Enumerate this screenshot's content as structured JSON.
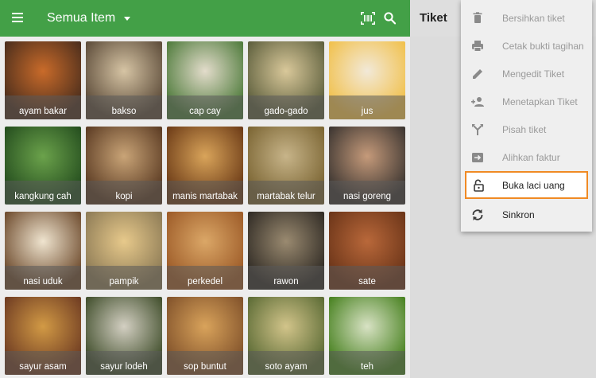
{
  "appbar": {
    "title": "Semua Item",
    "icons": [
      "menu-icon",
      "caret-down-icon",
      "barcode-scan-icon",
      "search-icon"
    ],
    "color": "#43a047"
  },
  "ticket": {
    "title": "Tiket"
  },
  "items": [
    {
      "label": "ayam bakar",
      "photo": [
        "#4a2d1c",
        "#c96b2a"
      ]
    },
    {
      "label": "bakso",
      "photo": [
        "#5b4a38",
        "#d6c4a4"
      ]
    },
    {
      "label": "cap cay",
      "photo": [
        "#4d7a3a",
        "#e3dccb"
      ]
    },
    {
      "label": "gado-gado",
      "photo": [
        "#5c5e3c",
        "#d9c89a"
      ]
    },
    {
      "label": "jus",
      "photo": [
        "#f1c04a",
        "#f2e9d8"
      ]
    },
    {
      "label": "kangkung cah",
      "photo": [
        "#244d1e",
        "#6ba24b"
      ]
    },
    {
      "label": "kopi",
      "photo": [
        "#5a3a22",
        "#c9a477"
      ]
    },
    {
      "label": "manis martabak",
      "photo": [
        "#6b3a16",
        "#d9a45a"
      ]
    },
    {
      "label": "martabak telur",
      "photo": [
        "#7a6432",
        "#c7b489"
      ]
    },
    {
      "label": "nasi goreng",
      "photo": [
        "#3a3430",
        "#c59a7a"
      ]
    },
    {
      "label": "nasi uduk",
      "photo": [
        "#6d4a2c",
        "#efe4cf"
      ]
    },
    {
      "label": "pampik",
      "photo": [
        "#8c7a55",
        "#e7c98b"
      ]
    },
    {
      "label": "perkedel",
      "photo": [
        "#9c5a27",
        "#dba767"
      ]
    },
    {
      "label": "rawon",
      "photo": [
        "#2f2a24",
        "#9a8a70"
      ]
    },
    {
      "label": "sate",
      "photo": [
        "#6a3418",
        "#b9683a"
      ]
    },
    {
      "label": "sayur asam",
      "photo": [
        "#6e3b22",
        "#d29a45"
      ]
    },
    {
      "label": "sayur lodeh",
      "photo": [
        "#3f4d2a",
        "#d3cfc2"
      ]
    },
    {
      "label": "sop buntut",
      "photo": [
        "#80512a",
        "#d9a35b"
      ]
    },
    {
      "label": "soto ayam",
      "photo": [
        "#5a6a34",
        "#d2c48a"
      ]
    },
    {
      "label": "teh",
      "photo": [
        "#46801e",
        "#d8e2c4"
      ]
    }
  ],
  "menu": {
    "items": [
      {
        "label": "Bersihkan tiket",
        "icon": "trash-icon"
      },
      {
        "label": "Cetak bukti tagihan",
        "icon": "printer-icon"
      },
      {
        "label": "Mengedit Tiket",
        "icon": "pencil-icon"
      },
      {
        "label": "Menetapkan Tiket",
        "icon": "assign-user-icon"
      },
      {
        "label": "Pisah tiket",
        "icon": "split-icon"
      },
      {
        "label": "Alihkan faktur",
        "icon": "transfer-icon"
      },
      {
        "label": "Buka laci uang",
        "icon": "unlock-icon",
        "highlight": true
      },
      {
        "label": "Sinkron",
        "icon": "sync-icon"
      }
    ],
    "highlight_color": "#f08a24"
  }
}
